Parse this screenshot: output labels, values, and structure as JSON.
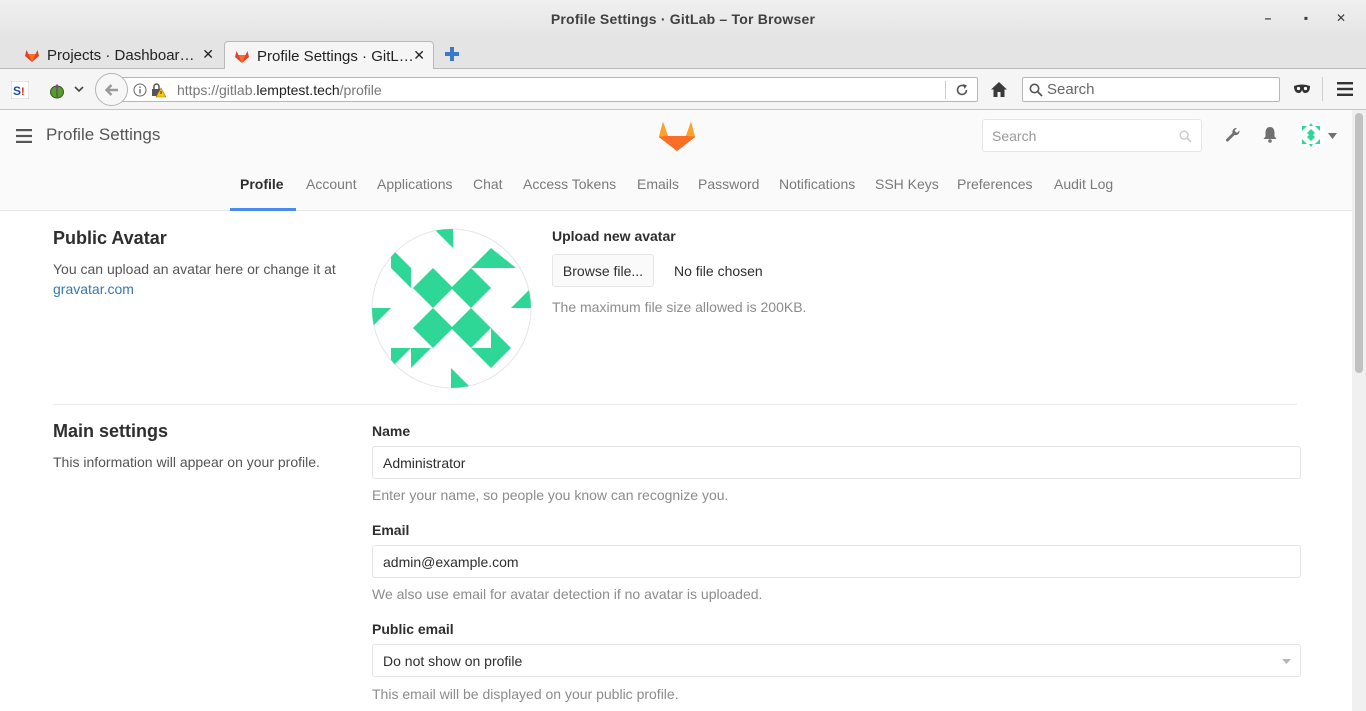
{
  "window": {
    "title": "Profile Settings · GitLab – Tor Browser"
  },
  "tabs": [
    {
      "label": "Projects · Dashboar…",
      "active": false
    },
    {
      "label": "Profile Settings · GitL…",
      "active": true
    }
  ],
  "nav": {
    "url_scheme": "https://gitlab.",
    "url_host": "lemptest.tech",
    "url_path": "/profile",
    "search_placeholder": "Search"
  },
  "header": {
    "page_title": "Profile Settings",
    "search_placeholder": "Search"
  },
  "subnav": [
    "Profile",
    "Account",
    "Applications",
    "Chat",
    "Access Tokens",
    "Emails",
    "Password",
    "Notifications",
    "SSH Keys",
    "Preferences",
    "Audit Log"
  ],
  "avatar_section": {
    "title": "Public Avatar",
    "desc": "You can upload an avatar here or change it at ",
    "link": "gravatar.com",
    "upload_label": "Upload new avatar",
    "browse_label": "Browse file...",
    "no_file": "No file chosen",
    "max_size": "The maximum file size allowed is 200KB."
  },
  "main_section": {
    "title": "Main settings",
    "desc": "This information will appear on your profile.",
    "name_label": "Name",
    "name_value": "Administrator",
    "name_help": "Enter your name, so people you know can recognize you.",
    "email_label": "Email",
    "email_value": "admin@example.com",
    "email_help": "We also use email for avatar detection if no avatar is uploaded.",
    "public_email_label": "Public email",
    "public_email_value": "Do not show on profile",
    "public_email_help": "This email will be displayed on your public profile."
  },
  "colors": {
    "accent_blue": "#4a8bee",
    "link": "#3777b0",
    "avatar_green": "#2fd797",
    "gitlab_orange": "#fc6d26"
  }
}
